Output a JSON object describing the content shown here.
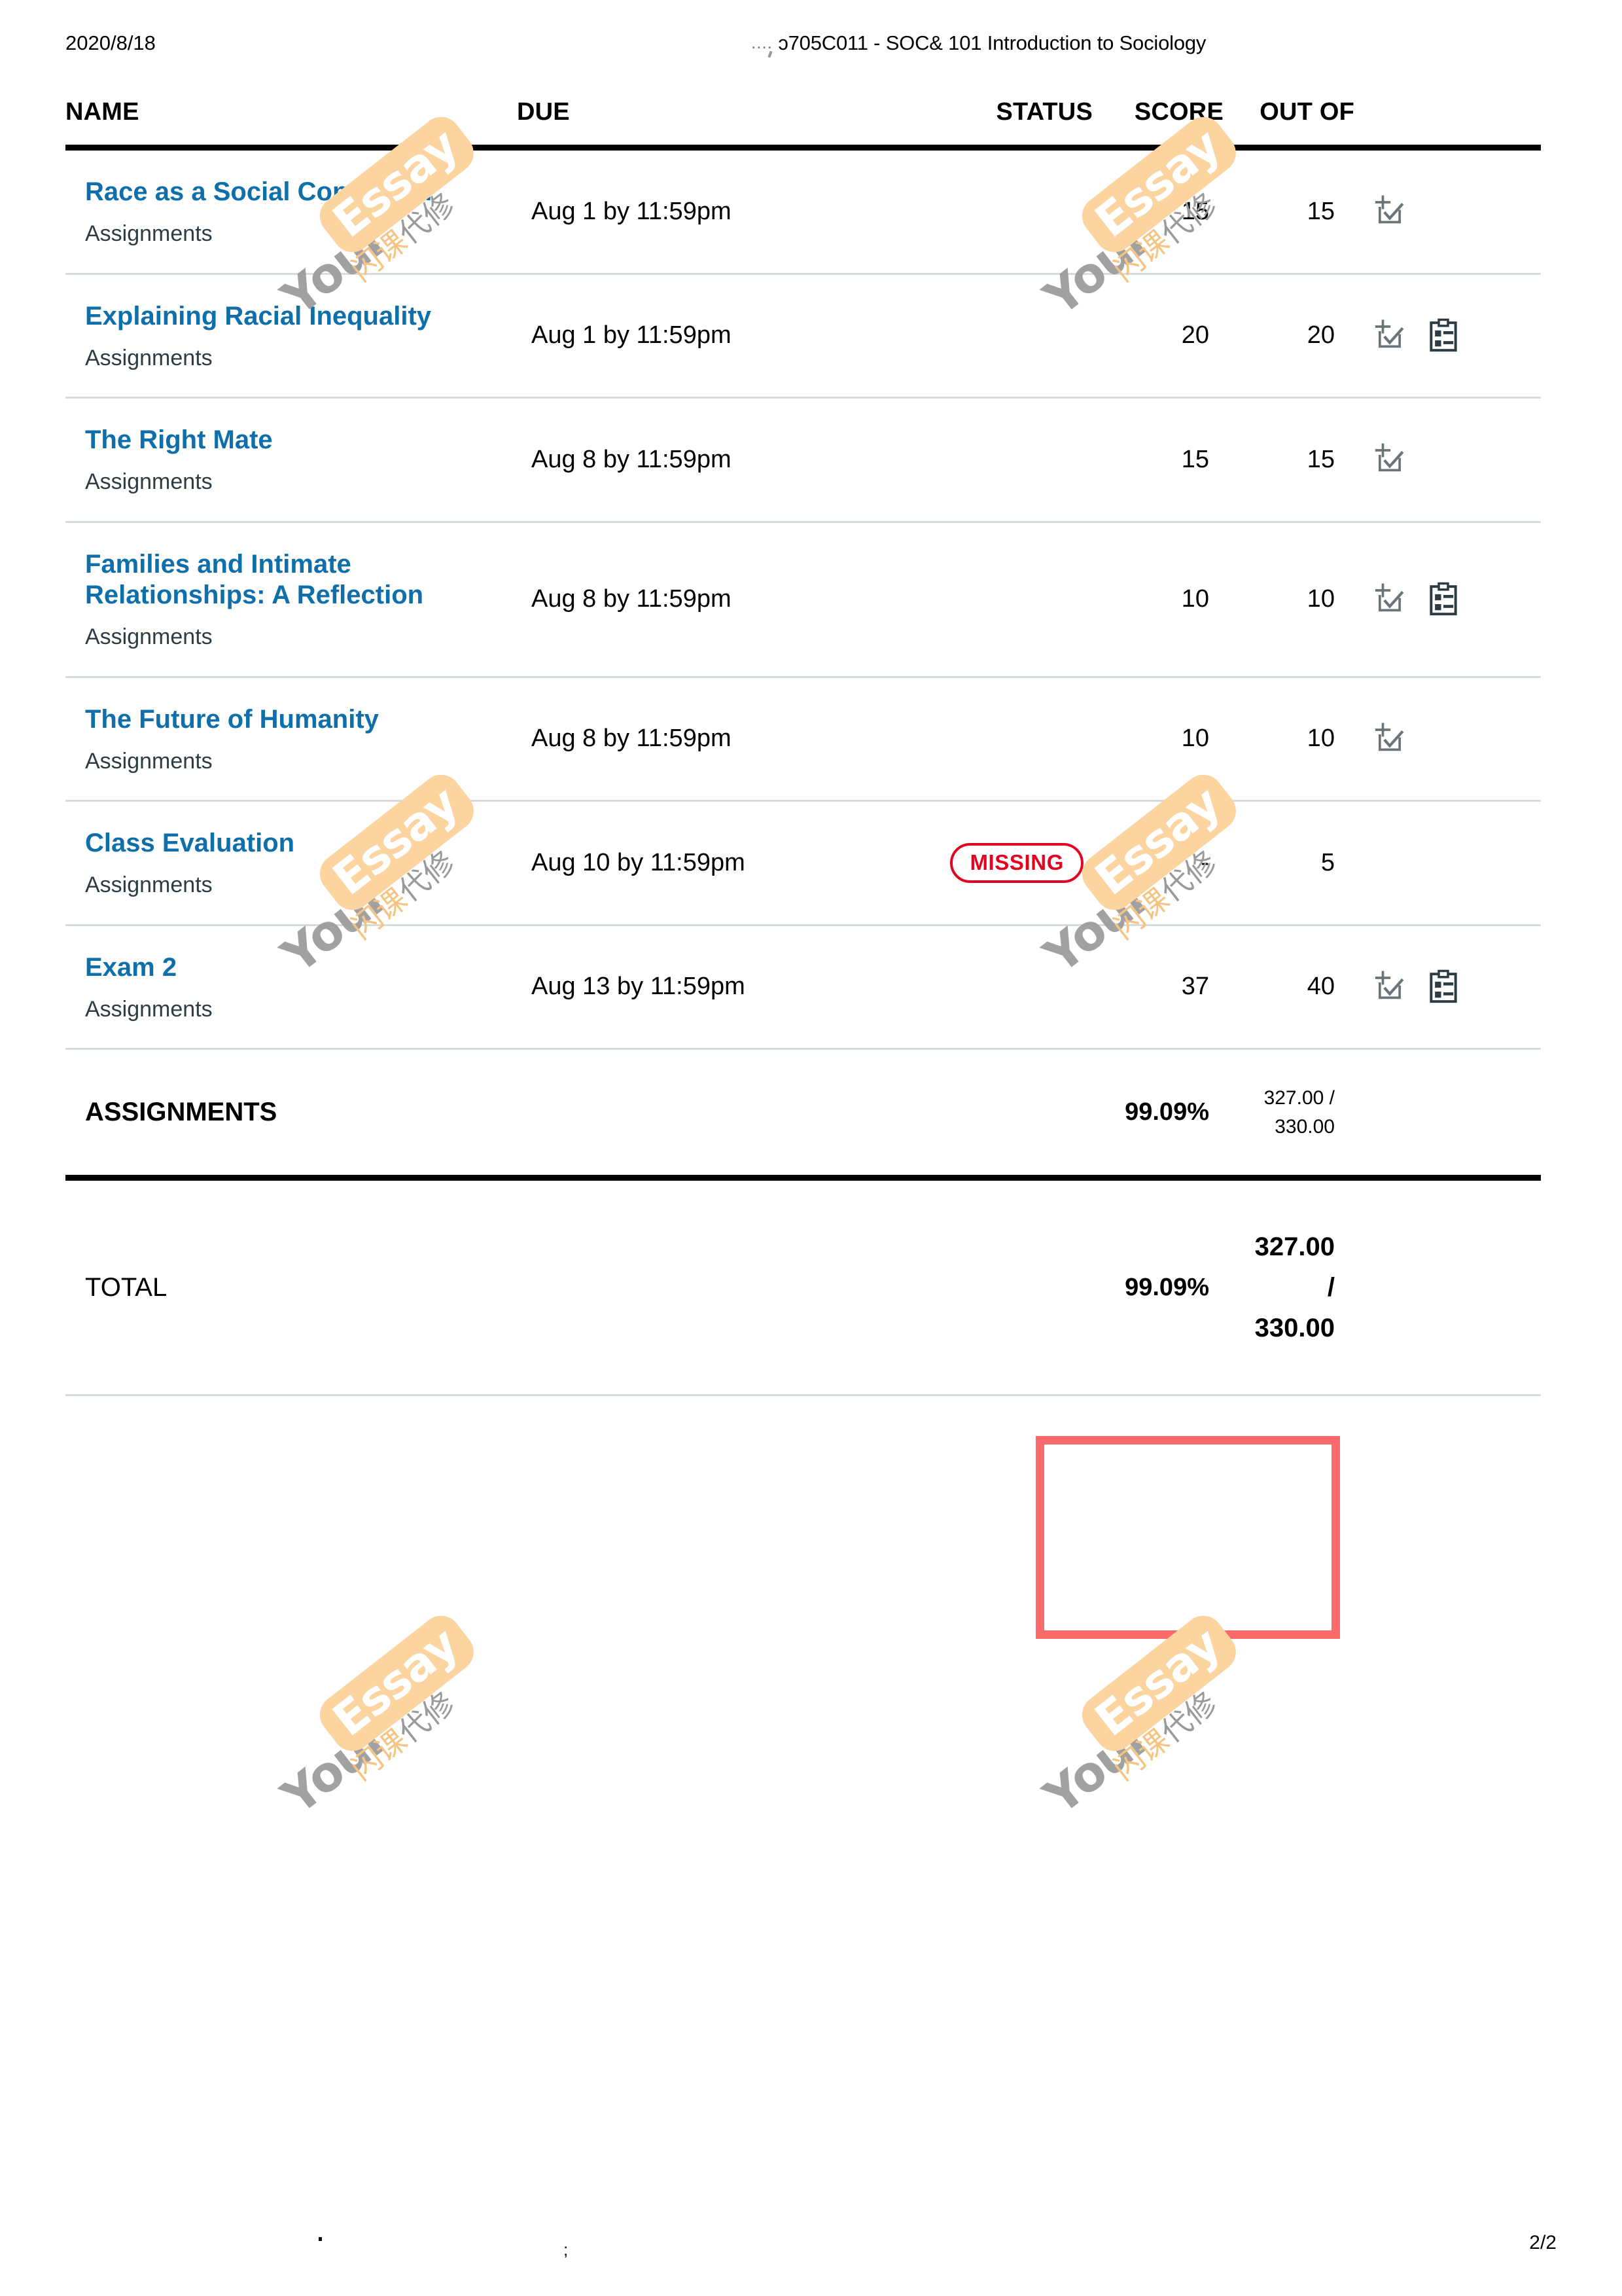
{
  "print_header": {
    "date": "2020/8/18",
    "ellipsis": "....",
    "course_title": "ᴐ705C011 - SOC& 101 Introduction to Sociology"
  },
  "table": {
    "columns": [
      "NAME",
      "DUE",
      "STATUS",
      "SCORE",
      "OUT OF"
    ],
    "rows": [
      {
        "name": "Race as a Social Construct?",
        "group": "Assignments",
        "due": "Aug 1 by 11:59pm",
        "status": "",
        "score": "15",
        "out_of": "15",
        "icons": [
          "rubric-icon"
        ]
      },
      {
        "name": "Explaining Racial Inequality",
        "group": "Assignments",
        "due": "Aug 1 by 11:59pm",
        "status": "",
        "score": "20",
        "out_of": "20",
        "icons": [
          "rubric-icon",
          "comment-icon"
        ]
      },
      {
        "name": "The Right Mate",
        "group": "Assignments",
        "due": "Aug 8 by 11:59pm",
        "status": "",
        "score": "15",
        "out_of": "15",
        "icons": [
          "rubric-icon"
        ]
      },
      {
        "name": "Families and Intimate Relationships: A Reflection",
        "group": "Assignments",
        "due": "Aug 8 by 11:59pm",
        "status": "",
        "score": "10",
        "out_of": "10",
        "icons": [
          "rubric-icon",
          "comment-icon"
        ]
      },
      {
        "name": "The Future of Humanity",
        "group": "Assignments",
        "due": "Aug 8 by 11:59pm",
        "status": "",
        "score": "10",
        "out_of": "10",
        "icons": [
          "rubric-icon"
        ]
      },
      {
        "name": "Class Evaluation",
        "group": "Assignments",
        "due": "Aug 10 by 11:59pm",
        "status": "MISSING",
        "score": "-",
        "out_of": "5",
        "icons": []
      },
      {
        "name": "Exam 2",
        "group": "Assignments",
        "due": "Aug 13 by 11:59pm",
        "status": "",
        "score": "37",
        "out_of": "40",
        "icons": [
          "rubric-icon",
          "comment-icon"
        ]
      }
    ],
    "group_summary": {
      "label": "ASSIGNMENTS",
      "percent": "99.09%",
      "earned": "327.00 /",
      "possible": "330.00"
    },
    "total": {
      "label": "TOTAL",
      "percent": "99.09%",
      "earned": "327.00",
      "slash": "/",
      "possible": "330.00"
    }
  },
  "footer": {
    "page": "2/2",
    "mark_b": ";"
  },
  "watermark": {
    "your": "Your",
    "essay": "Essay",
    "cn_left": "闪课",
    "cn_right": "代修"
  },
  "colors": {
    "link": "#0e6fab",
    "missing": "#e0061f",
    "highlight": "#fb6a6a",
    "rule": "#d6dbde",
    "watermark_orange": "#fbd4a0",
    "watermark_gray": "#9a9a9a"
  }
}
